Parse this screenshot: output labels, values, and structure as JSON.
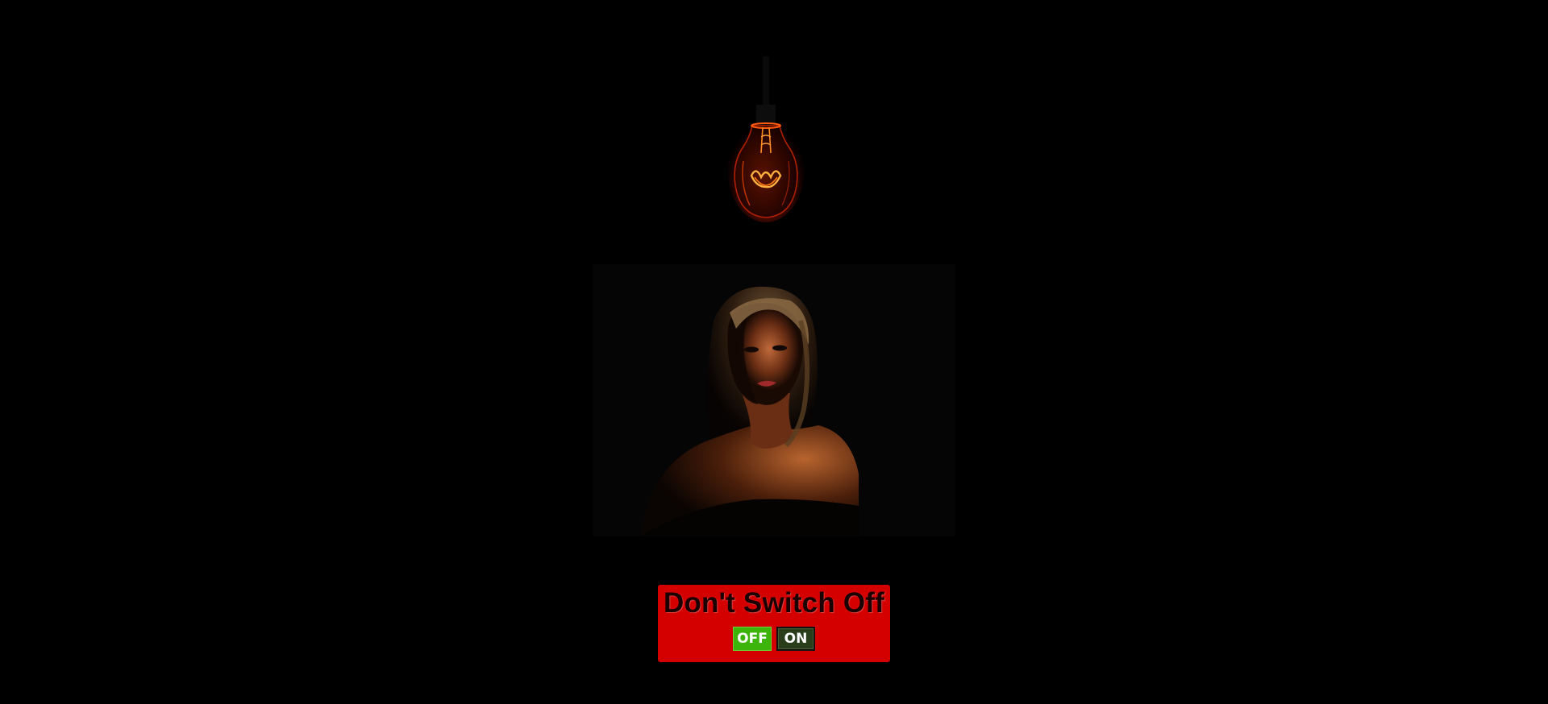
{
  "scene": {
    "background": "#000000",
    "bulb_icon": "lightbulb-icon",
    "bulb_glow_color": "#ff6a00",
    "portrait_image": "woman-portrait-dim-lighting"
  },
  "panel": {
    "title": "Don't Switch Off",
    "background": "#d40000",
    "off_label": "OFF",
    "on_label": "ON",
    "off_color": "#3cb40a",
    "on_color": "#2a3d1a"
  }
}
